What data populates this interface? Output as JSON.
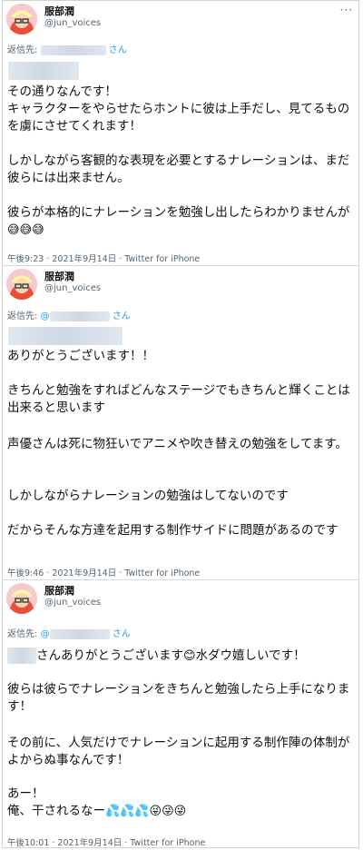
{
  "tweets": [
    {
      "name": "服部潤",
      "handle": "@jun_voices",
      "reply_label": "返信先:",
      "reply_prefix": "",
      "reply_suffix": "さん",
      "p1": "その通りなんです！\nキャラクターをやらせたらホントに彼は上手だし、見てるものを虜にさせてくれます！",
      "p2": "しかしながら客観的な表現を必要とするナレーションは、まだ彼らには出来ません。",
      "p3": "彼らが本格的にナレーションを勉強し出したらわかりませんが",
      "p3_emoji": "😅😅😅",
      "footer": "午後9:23 · 2021年9月14日 · Twitter for iPhone"
    },
    {
      "name": "服部潤",
      "handle": "@jun_voices",
      "reply_label": "返信先:",
      "reply_prefix": "@",
      "reply_suffix": "さん",
      "p1": "ありがとうございます！！",
      "p2": "きちんと勉強をすればどんなステージでもきちんと輝くことは出来ると思います",
      "p3": "声優さんは死に物狂いでアニメや吹き替えの勉強をしてます。",
      "p4": "しかしながらナレーションの勉強はしてないのです",
      "p5": "だからそんな方達を起用する制作サイドに問題があるのです",
      "footer": "午後9:46 · 2021年9月14日 · Twitter for iPhone"
    },
    {
      "name": "服部潤",
      "handle": "@jun_voices",
      "reply_label": "返信先:",
      "reply_prefix": "@",
      "reply_suffix": "さん",
      "p1a": "さんありがとうございます",
      "p1_emoji": "😊",
      "p1b": "水ダウ嬉しいです！",
      "p2": "彼らは彼らでナレーションをきちんと勉強したら上手になります！",
      "p3": "その前に、人気だけでナレーションに起用する制作陣の体制がよからぬ事なんです！",
      "p4": "あー！\n俺、干されるなー",
      "p4_emoji": "💦💦💦😜😜😜",
      "footer": "午後10:01 · 2021年9月14日 · Twitter for iPhone"
    }
  ],
  "more_icon": "more-horizontal-icon"
}
